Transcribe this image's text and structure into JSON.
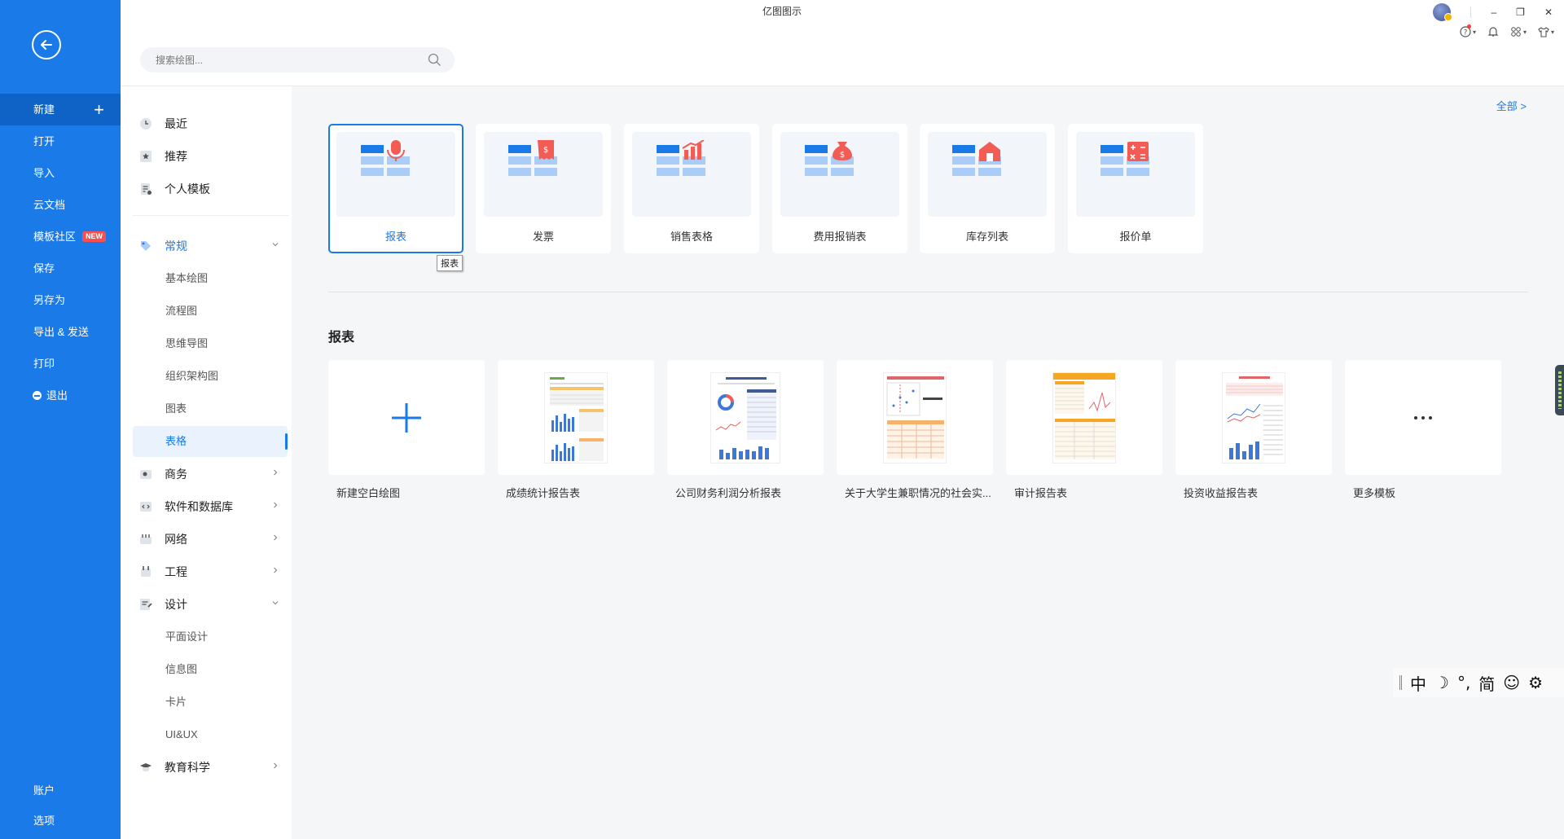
{
  "app": {
    "title": "亿图图示"
  },
  "left_menu": {
    "items": [
      {
        "label": "新建"
      },
      {
        "label": "打开"
      },
      {
        "label": "导入"
      },
      {
        "label": "云文档"
      },
      {
        "label": "模板社区",
        "badge": "NEW"
      },
      {
        "label": "保存"
      },
      {
        "label": "另存为"
      },
      {
        "label": "导出 & 发送"
      },
      {
        "label": "打印"
      },
      {
        "label": "退出"
      }
    ],
    "bottom": [
      {
        "label": "账户"
      },
      {
        "label": "选项"
      }
    ]
  },
  "search": {
    "placeholder": "搜索绘图..."
  },
  "categories": {
    "top": [
      {
        "label": "最近"
      },
      {
        "label": "推荐"
      },
      {
        "label": "个人模板"
      }
    ],
    "groups": [
      {
        "label": "常规",
        "subs": [
          {
            "label": "基本绘图"
          },
          {
            "label": "流程图"
          },
          {
            "label": "思维导图"
          },
          {
            "label": "组织架构图"
          },
          {
            "label": "图表"
          },
          {
            "label": "表格"
          }
        ]
      },
      {
        "label": "商务"
      },
      {
        "label": "软件和数据库"
      },
      {
        "label": "网络"
      },
      {
        "label": "工程"
      },
      {
        "label": "设计",
        "subs": [
          {
            "label": "平面设计"
          },
          {
            "label": "信息图"
          },
          {
            "label": "卡片"
          },
          {
            "label": "UI&UX"
          }
        ]
      },
      {
        "label": "教育科学"
      }
    ]
  },
  "main": {
    "all_link": "全部 >",
    "tooltip": "报表",
    "section_title": "报表",
    "type_cards": [
      {
        "label": "报表",
        "icon": "microphone-icon"
      },
      {
        "label": "发票",
        "icon": "receipt-icon"
      },
      {
        "label": "销售表格",
        "icon": "trend-chart-icon"
      },
      {
        "label": "费用报销表",
        "icon": "money-bag-icon"
      },
      {
        "label": "库存列表",
        "icon": "warehouse-icon"
      },
      {
        "label": "报价单",
        "icon": "calculator-icon"
      }
    ],
    "templates": [
      {
        "label": "新建空白绘图"
      },
      {
        "label": "成绩统计报告表"
      },
      {
        "label": "公司财务利润分析报表"
      },
      {
        "label": "关于大学生兼职情况的社会实..."
      },
      {
        "label": "审计报告表"
      },
      {
        "label": "投资收益报告表"
      },
      {
        "label": "更多模板"
      }
    ]
  },
  "ime": {
    "lang": "中",
    "moon": "☽",
    "punct": "°,",
    "script": "简",
    "emoji": "☺",
    "settings": "⚙"
  },
  "colors": {
    "sidebar": "#1a7ae8",
    "accent": "#1a7ae8",
    "icon_red": "#f25c54",
    "table_dark": "#1a7ae8",
    "table_light": "#a9cdf6"
  }
}
